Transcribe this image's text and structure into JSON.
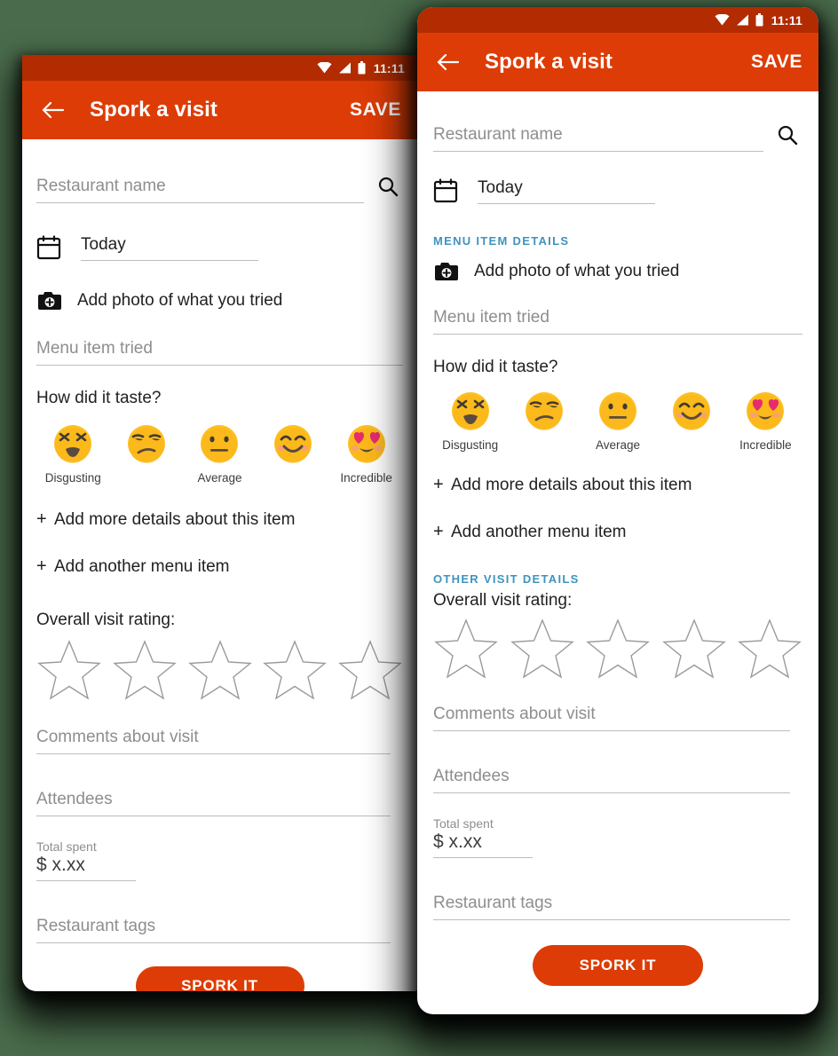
{
  "page": {
    "background_color": "#4a6c4c",
    "accent_orange": "#dd3c06",
    "statusbar_orange": "#b32b00",
    "section_header_color": "#3f93bd"
  },
  "statusbar": {
    "time": "11:11",
    "icons": [
      "wifi-icon",
      "signal-icon",
      "battery-icon"
    ]
  },
  "appbar": {
    "back_icon": "back-arrow-icon",
    "title": "Spork a visit",
    "save_label": "SAVE"
  },
  "form": {
    "restaurant_name_placeholder": "Restaurant name",
    "search_icon": "search-icon",
    "calendar_icon": "calendar-icon",
    "date_value": "Today",
    "camera_icon": "add-photo-camera-icon",
    "add_photo_label": "Add photo of what you tried",
    "menu_item_placeholder": "Menu item tried",
    "taste_question": "How did it taste?",
    "taste_options": [
      {
        "icon": "emoji-disgusted",
        "label": "Disgusting",
        "show_label": true
      },
      {
        "icon": "emoji-unamused",
        "label": "",
        "show_label": false
      },
      {
        "icon": "emoji-neutral",
        "label": "Average",
        "show_label": true
      },
      {
        "icon": "emoji-smiling",
        "label": "",
        "show_label": false
      },
      {
        "icon": "emoji-heart-eyes",
        "label": "Incredible",
        "show_label": true
      }
    ],
    "add_more_details_label": "Add more details about this item",
    "add_another_item_label": "Add another menu item",
    "plus_symbol": "+",
    "overall_rating_label": "Overall visit rating:",
    "star_count": 5,
    "stars_filled": 0,
    "comments_placeholder": "Comments about visit",
    "attendees_placeholder": "Attendees",
    "total_spent_label": "Total spent",
    "total_spent_value": "$ x.xx",
    "restaurant_tags_placeholder": "Restaurant tags",
    "submit_label": "SPORK IT"
  },
  "sections": {
    "menu_item_details": "MENU ITEM DETAILS",
    "other_visit_details": "OTHER VISIT DETAILS"
  }
}
